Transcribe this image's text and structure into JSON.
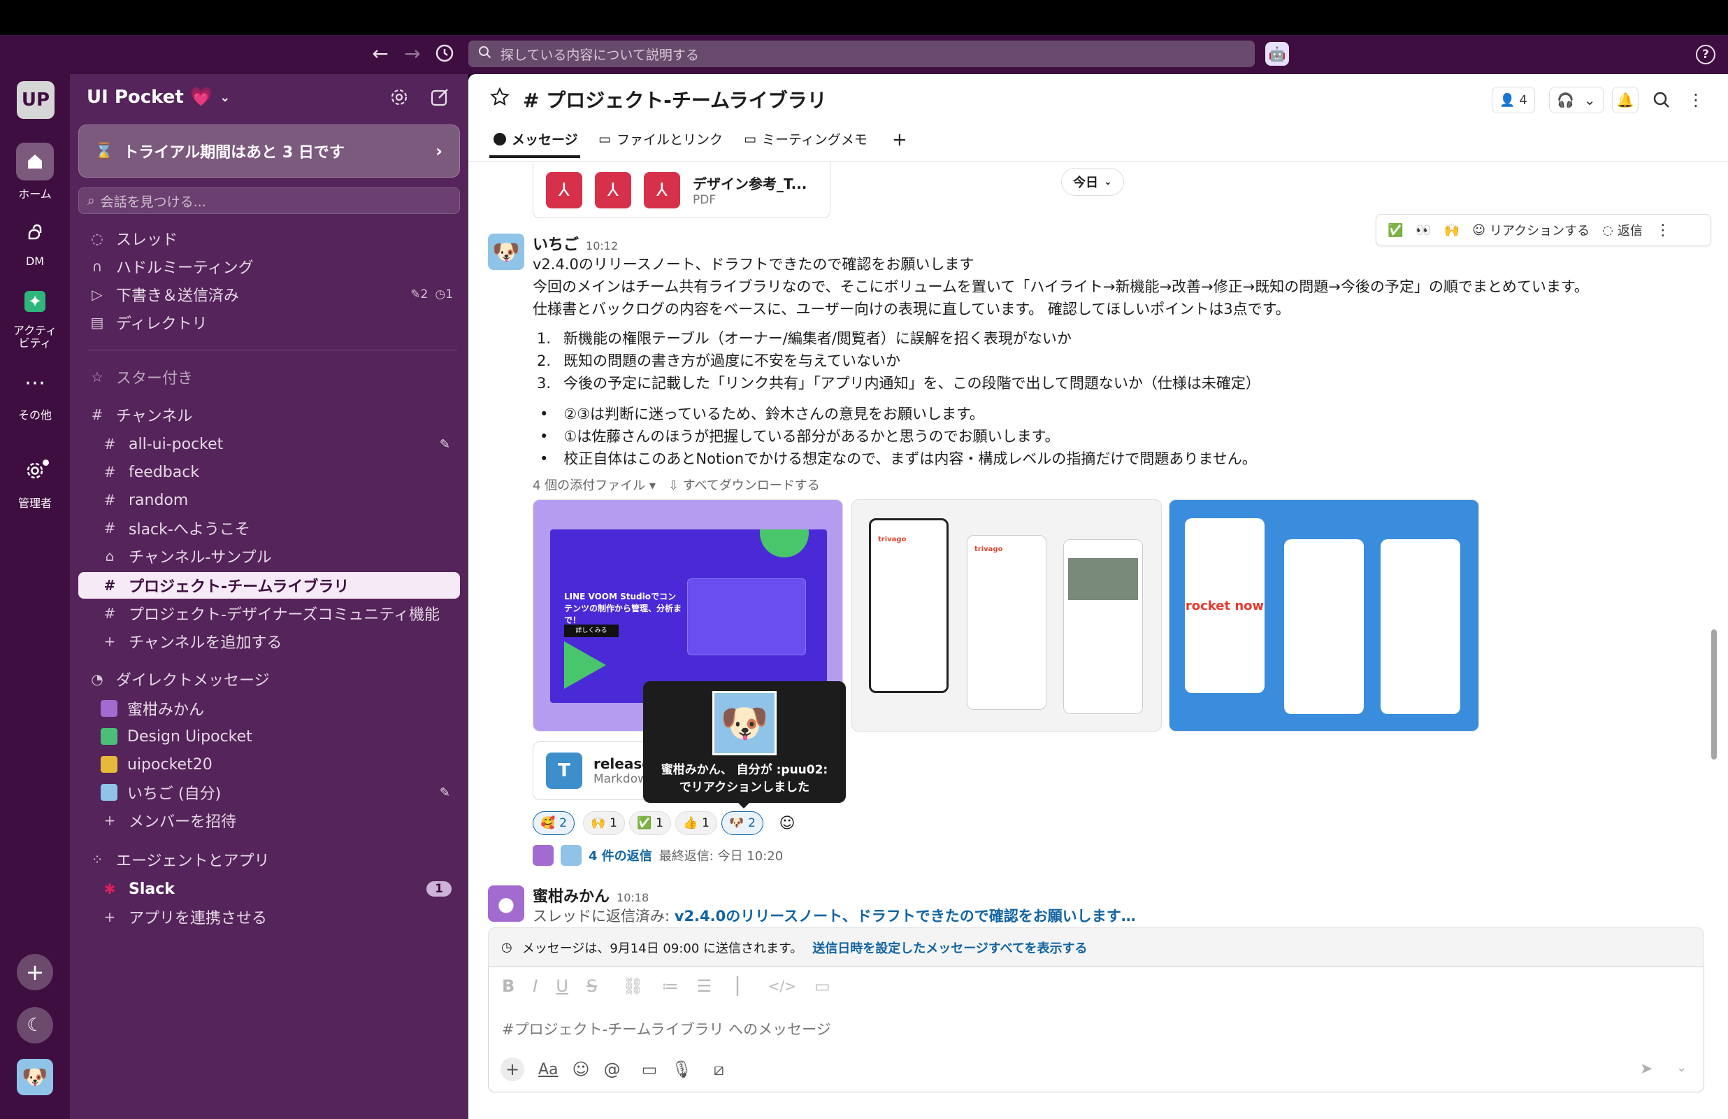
{
  "workspace": {
    "name": "UI Pocket 💗",
    "initials": "UP",
    "trial": "トライアル期間はあと 3 日です",
    "find_placeholder": "会話を見つける..."
  },
  "search": {
    "placeholder": "探している内容について説明する"
  },
  "rail": [
    {
      "label": "ホーム",
      "icon": "home-icon"
    },
    {
      "label": "DM",
      "icon": "dm-icon"
    },
    {
      "label": "アクティビティ",
      "icon": "activity-icon"
    },
    {
      "label": "その他",
      "icon": "more-icon"
    },
    {
      "label": "管理者",
      "icon": "gear-icon"
    }
  ],
  "sidebar": {
    "top": [
      {
        "label": "スレッド",
        "icon": "thread-icon"
      },
      {
        "label": "ハドルミーティング",
        "icon": "headphones-icon"
      },
      {
        "label": "下書き＆送信済み",
        "icon": "send-icon",
        "badge1": "2",
        "badge2": "1"
      },
      {
        "label": "ディレクトリ",
        "icon": "directory-icon"
      }
    ],
    "starred": "スター付き",
    "channels_title": "チャンネル",
    "channels": [
      "all-ui-pocket",
      "feedback",
      "random",
      "slack-へようこそ",
      "チャンネル-サンプル",
      "プロジェクト-チームライブラリ",
      "プロジェクト-デザイナーズコミュニティ機能"
    ],
    "add_channel": "チャンネルを追加する",
    "dm_title": "ダイレクトメッセージ",
    "dms": [
      "蜜柑みかん",
      "Design Uipocket",
      "uipocket20",
      "いちご (自分)"
    ],
    "invite": "メンバーを招待",
    "apps_title": "エージェントとアプリ",
    "app_slack": "Slack",
    "app_slack_badge": "1",
    "add_app": "アプリを連携させる"
  },
  "channel": {
    "title": "# プロジェクト-チームライブラリ",
    "members": "4",
    "tabs": [
      "メッセージ",
      "ファイルとリンク",
      "ミーティングメモ"
    ]
  },
  "prev_file": {
    "name": "デザイン参考_T...",
    "type": "PDF"
  },
  "date_pill": "今日",
  "hover_toolbar": {
    "react": "リアクションする",
    "reply": "返信"
  },
  "message": {
    "author": "いちご",
    "time": "10:12",
    "lines": [
      "v2.4.0のリリースノート、ドラフトできたので確認をお願いします",
      "今回のメインはチーム共有ライブラリなので、そこにボリュームを置いて「ハイライト→新機能→改善→修正→既知の問題→今後の予定」の順でまとめています。",
      "仕様書とバックログの内容をベースに、ユーザー向けの表現に直しています。 確認してほしいポイントは3点です。"
    ],
    "numbered": [
      "新機能の権限テーブル（オーナー/編集者/閲覧者）に誤解を招く表現がないか",
      "既知の問題の書き方が過度に不安を与えていないか",
      "今後の予定に記載した「リンク共有」「アプリ内通知」を、この段階で出して問題ないか（仕様は未確定）"
    ],
    "bullets": [
      "②③は判断に迷っているため、鈴木さんの意見をお願いします。",
      "①は佐藤さんのほうが把握している部分があるかと思うのでお願いします。",
      "校正自体はこのあとNotionでかける想定なので、まずは内容・構成レベルの指摘だけで問題ありません。"
    ],
    "attachments": "4 個の添付ファイル",
    "download_all": "すべてダウンロードする",
    "thumb1_text": "LINE VOOM Studioでコンテンツの制作から管理、分析まで！",
    "thumb1_button": "詳しくみる",
    "thumb2_brand": "trivago",
    "thumb3_brand": "rocket now",
    "file_name": "release",
    "file_type": "Markdow",
    "reactions": [
      {
        "emoji": "🥰",
        "count": "2"
      },
      {
        "emoji": "🙌",
        "count": "1"
      },
      {
        "emoji": "✅",
        "count": "1"
      },
      {
        "emoji": "👍",
        "count": "1"
      },
      {
        "emoji": "🐶",
        "count": "2"
      }
    ],
    "replies": "4 件の返信",
    "last_reply": "最終返信: 今日 10:20"
  },
  "tooltip": {
    "line1": "蜜柑みかん、 自分が :puu02:",
    "line2": "でリアクションしました"
  },
  "message2": {
    "author": "蜜柑みかん",
    "time": "10:18",
    "prefix": "スレッドに返信済み: ",
    "link": "v2.4.0のリリースノート、ドラフトできたので確認をお願いします…"
  },
  "scheduled": {
    "text": "メッセージは、9月14日 09:00 に送信されます。",
    "link": "送信日時を設定したメッセージすべてを表示する"
  },
  "composer": {
    "placeholder": "#プロジェクト-チームライブラリ へのメッセージ"
  },
  "colors": {
    "aubergine": "#3f0e40",
    "sidebar": "#55245a",
    "link": "#1264a3",
    "accent_green": "#2eb67d"
  }
}
